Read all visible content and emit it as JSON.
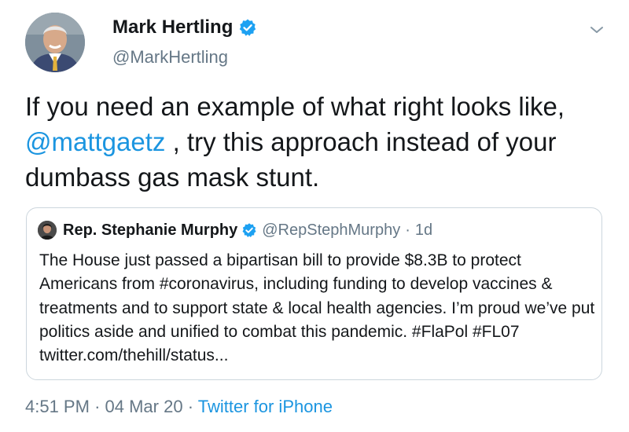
{
  "author": {
    "name": "Mark Hertling",
    "handle": "@MarkHertling",
    "avatar_icon": "user-avatar-photo"
  },
  "tweet": {
    "text_part1": "If you need an example of what right looks like,",
    "mention": "@mattgaetz",
    "text_part2": " , try this approach instead of your dumbass gas mask stunt."
  },
  "quoted_tweet": {
    "name": "Rep. Stephanie Murphy",
    "handle": "@RepStephMurphy",
    "separator": "·",
    "age": "1d",
    "text": "The House just passed a bipartisan bill to provide $8.3B to protect Americans from #coronavirus, including funding to develop vaccines & treatments and to support state & local health agencies. I’m proud we’ve put politics aside and unified to combat this pandemic. #FlaPol #FL07 twitter.com/thehill/status..."
  },
  "footer": {
    "time": "4:51 PM",
    "sep1": "·",
    "date": "04 Mar 20",
    "sep2": "·",
    "source": "Twitter for iPhone"
  },
  "colors": {
    "link": "#1b95e0",
    "secondary_text": "#657786",
    "border": "#ccd6dd",
    "verified_badge": "#1da1f2"
  }
}
